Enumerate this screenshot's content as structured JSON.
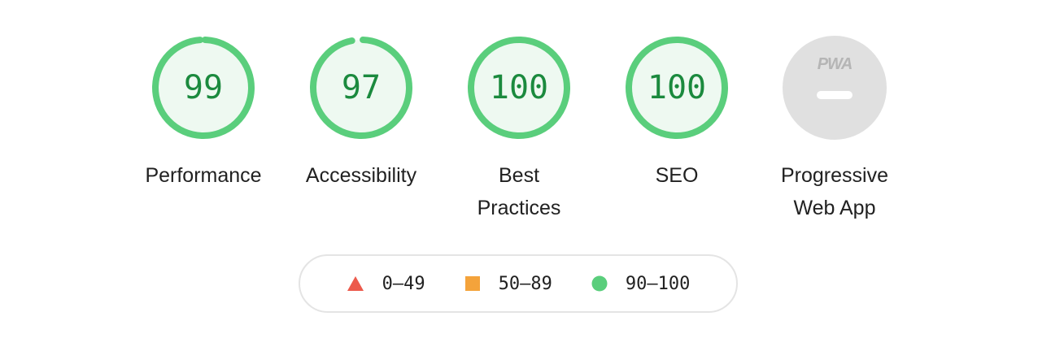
{
  "colors": {
    "pass": "#5ace7c",
    "pass_fill": "#eef9f1",
    "pass_text": "#1b8a3e",
    "average": "#f4a33b",
    "fail": "#ec5a4c",
    "na": "#e0e0e0",
    "na_text": "#b5b5b5"
  },
  "gauges": [
    {
      "id": "performance",
      "score": "99",
      "label": "Performance",
      "fraction": 0.99,
      "status": "pass"
    },
    {
      "id": "accessibility",
      "score": "97",
      "label": "Accessibility",
      "fraction": 0.97,
      "status": "pass"
    },
    {
      "id": "best-practices",
      "score": "100",
      "label": "Best Practices",
      "fraction": 1.0,
      "status": "pass"
    },
    {
      "id": "seo",
      "score": "100",
      "label": "SEO",
      "fraction": 1.0,
      "status": "pass"
    }
  ],
  "pwa": {
    "badge_text": "PWA",
    "label": "Progressive Web App",
    "icon": "pwa-icon"
  },
  "legend": [
    {
      "shape": "triangle",
      "range": "0–49",
      "status": "fail"
    },
    {
      "shape": "square",
      "range": "50–89",
      "status": "average"
    },
    {
      "shape": "circle",
      "range": "90–100",
      "status": "pass"
    }
  ]
}
